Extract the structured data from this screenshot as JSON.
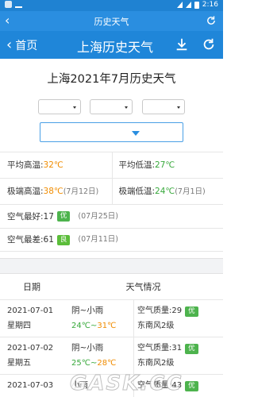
{
  "statusbar": {
    "time": "2:16"
  },
  "appbar": {
    "back_label": "‹",
    "title": "历史天气"
  },
  "webhead": {
    "home_label": "首页",
    "title": "上海历史天气"
  },
  "page": {
    "title": "上海2021年7月历史天气"
  },
  "stats": {
    "avg_high_label": "平均高温:",
    "avg_high": "32℃",
    "avg_low_label": "平均低温:",
    "avg_low": "27℃",
    "max_high_label": "极端高温:",
    "max_high": "38℃",
    "max_high_date": "(7月12日)",
    "min_low_label": "极端低温:",
    "min_low": "24℃",
    "min_low_date": "(7月1日)",
    "best_air_label": "空气最好:17",
    "best_air_badge": "优",
    "best_air_date": "(07月25日)",
    "worst_air_label": "空气最差:61",
    "worst_air_badge": "良",
    "worst_air_date": "(07月11日)"
  },
  "table": {
    "headers": [
      "日期",
      "天气情况"
    ],
    "rows": [
      {
        "date": "2021-07-01",
        "weekday": "星期四",
        "weather": "阴~小雨",
        "low": "24℃",
        "high": "31℃",
        "air": "空气质量:29",
        "air_badge": "优",
        "wind": "东南风2级"
      },
      {
        "date": "2021-07-02",
        "weekday": "星期五",
        "weather": "阴~小雨",
        "low": "25℃",
        "high": "28℃",
        "air": "空气质量:31",
        "air_badge": "优",
        "wind": "东南风2级"
      },
      {
        "date": "2021-07-03",
        "weekday": "",
        "weather": "小雨",
        "low": "",
        "high": "",
        "air": "空气质量:43",
        "air_badge": "优",
        "wind": ""
      }
    ]
  },
  "watermark": "GASK.CC",
  "colors": {
    "appbar": "#2a8ee0",
    "accent_orange": "#f08c00",
    "accent_green": "#36a83a",
    "badge_green": "#4db34d"
  }
}
